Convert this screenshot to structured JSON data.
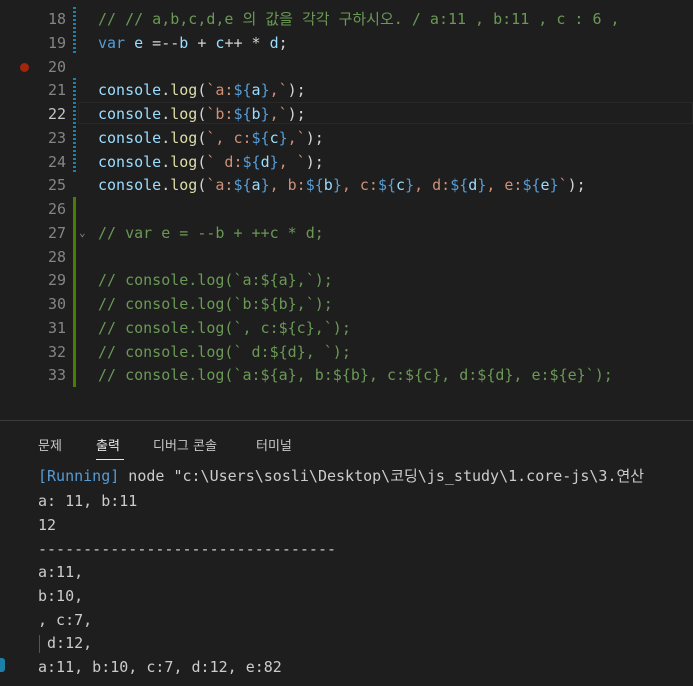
{
  "editor": {
    "lines": [
      {
        "num": "18",
        "segments": [
          {
            "t": "// // a,b,c,d,e 의 값을 각각 구하시오. / a:11 , b:11 , c : 6 ,",
            "c": "cm"
          }
        ]
      },
      {
        "num": "19",
        "segments": [
          {
            "t": "var ",
            "c": "kw"
          },
          {
            "t": "e",
            "c": "vr"
          },
          {
            "t": " =--",
            "c": "op"
          },
          {
            "t": "b",
            "c": "vr"
          },
          {
            "t": " + ",
            "c": "op"
          },
          {
            "t": "c",
            "c": "vr"
          },
          {
            "t": "++ * ",
            "c": "op"
          },
          {
            "t": "d",
            "c": "vr"
          },
          {
            "t": ";",
            "c": "op"
          }
        ]
      },
      {
        "num": "20",
        "segments": []
      },
      {
        "num": "21",
        "segments": [
          {
            "t": "console",
            "c": "vr"
          },
          {
            "t": ".",
            "c": "op"
          },
          {
            "t": "log",
            "c": "fn"
          },
          {
            "t": "(",
            "c": "op"
          },
          {
            "t": "`a:",
            "c": "st"
          },
          {
            "t": "${",
            "c": "tp"
          },
          {
            "t": "a",
            "c": "vr"
          },
          {
            "t": "}",
            "c": "tp"
          },
          {
            "t": ",`",
            "c": "st"
          },
          {
            "t": ");",
            "c": "op"
          }
        ]
      },
      {
        "num": "22",
        "segments": [
          {
            "t": "console",
            "c": "vr"
          },
          {
            "t": ".",
            "c": "op"
          },
          {
            "t": "log",
            "c": "fn"
          },
          {
            "t": "(",
            "c": "op"
          },
          {
            "t": "`b:",
            "c": "st"
          },
          {
            "t": "${",
            "c": "tp"
          },
          {
            "t": "b",
            "c": "vr"
          },
          {
            "t": "}",
            "c": "tp"
          },
          {
            "t": ",`",
            "c": "st"
          },
          {
            "t": ");",
            "c": "op"
          }
        ]
      },
      {
        "num": "23",
        "segments": [
          {
            "t": "console",
            "c": "vr"
          },
          {
            "t": ".",
            "c": "op"
          },
          {
            "t": "log",
            "c": "fn"
          },
          {
            "t": "(",
            "c": "op"
          },
          {
            "t": "`, c:",
            "c": "st"
          },
          {
            "t": "${",
            "c": "tp"
          },
          {
            "t": "c",
            "c": "vr"
          },
          {
            "t": "}",
            "c": "tp"
          },
          {
            "t": ",`",
            "c": "st"
          },
          {
            "t": ");",
            "c": "op"
          }
        ]
      },
      {
        "num": "24",
        "segments": [
          {
            "t": "console",
            "c": "vr"
          },
          {
            "t": ".",
            "c": "op"
          },
          {
            "t": "log",
            "c": "fn"
          },
          {
            "t": "(",
            "c": "op"
          },
          {
            "t": "` d:",
            "c": "st"
          },
          {
            "t": "${",
            "c": "tp"
          },
          {
            "t": "d",
            "c": "vr"
          },
          {
            "t": "}",
            "c": "tp"
          },
          {
            "t": ", `",
            "c": "st"
          },
          {
            "t": ");",
            "c": "op"
          }
        ]
      },
      {
        "num": "25",
        "segments": [
          {
            "t": "console",
            "c": "vr"
          },
          {
            "t": ".",
            "c": "op"
          },
          {
            "t": "log",
            "c": "fn"
          },
          {
            "t": "(",
            "c": "op"
          },
          {
            "t": "`a:",
            "c": "st"
          },
          {
            "t": "${",
            "c": "tp"
          },
          {
            "t": "a",
            "c": "vr"
          },
          {
            "t": "}",
            "c": "tp"
          },
          {
            "t": ", b:",
            "c": "st"
          },
          {
            "t": "${",
            "c": "tp"
          },
          {
            "t": "b",
            "c": "vr"
          },
          {
            "t": "}",
            "c": "tp"
          },
          {
            "t": ", c:",
            "c": "st"
          },
          {
            "t": "${",
            "c": "tp"
          },
          {
            "t": "c",
            "c": "vr"
          },
          {
            "t": "}",
            "c": "tp"
          },
          {
            "t": ", d:",
            "c": "st"
          },
          {
            "t": "${",
            "c": "tp"
          },
          {
            "t": "d",
            "c": "vr"
          },
          {
            "t": "}",
            "c": "tp"
          },
          {
            "t": ", e:",
            "c": "st"
          },
          {
            "t": "${",
            "c": "tp"
          },
          {
            "t": "e",
            "c": "vr"
          },
          {
            "t": "}",
            "c": "tp"
          },
          {
            "t": "`",
            "c": "st"
          },
          {
            "t": ");",
            "c": "op"
          }
        ]
      },
      {
        "num": "26",
        "segments": []
      },
      {
        "num": "27",
        "segments": [
          {
            "t": "// var e = --b + ++c * d;",
            "c": "cm"
          }
        ]
      },
      {
        "num": "28",
        "segments": []
      },
      {
        "num": "29",
        "segments": [
          {
            "t": "// console.log(`a:${a},`);",
            "c": "cm"
          }
        ]
      },
      {
        "num": "30",
        "segments": [
          {
            "t": "// console.log(`b:${b},`);",
            "c": "cm"
          }
        ]
      },
      {
        "num": "31",
        "segments": [
          {
            "t": "// console.log(`, c:${c},`);",
            "c": "cm"
          }
        ]
      },
      {
        "num": "32",
        "segments": [
          {
            "t": "// console.log(` d:${d}, `);",
            "c": "cm"
          }
        ]
      },
      {
        "num": "33",
        "segments": [
          {
            "t": "// console.log(`a:${a}, b:${b}, c:${c}, d:${d}, e:${e}`);",
            "c": "cm"
          }
        ]
      }
    ]
  },
  "panel": {
    "tabs": [
      "문제",
      "출력",
      "디버그 콘솔",
      "터미널"
    ],
    "active_tab": "출력",
    "output": {
      "running_tag": "[Running]",
      "running_cmd": " node \"c:\\Users\\sosli\\Desktop\\코딩\\js_study\\1.core-js\\3.연산",
      "lines": [
        "a: 11, b:11",
        "12",
        "---------------------------------",
        "a:11,",
        "b:10,",
        ", c:7,",
        " d:12,",
        "a:11, b:10, c:7, d:12, e:82"
      ]
    }
  },
  "colors": {
    "background": "#1e1e1e",
    "comment": "#6a9955",
    "keyword": "#569cd6",
    "variable": "#9cdcfe",
    "function": "#dcdcaa",
    "string": "#ce9178",
    "modified_bar": "#1b81a8",
    "added_bar": "#487e02",
    "breakpoint": "#a1260d"
  }
}
